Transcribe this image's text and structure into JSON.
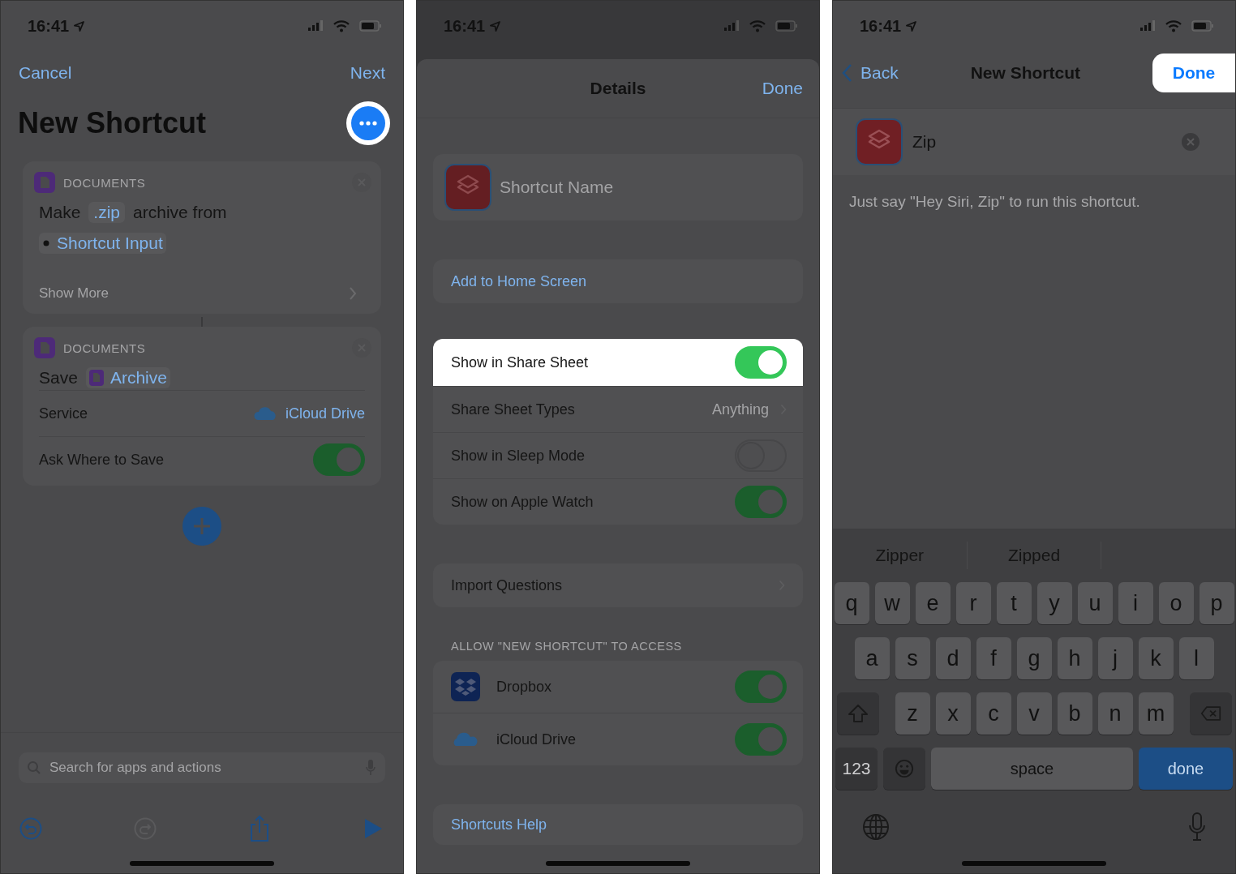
{
  "editor": {
    "status_time": "16:41",
    "cancel": "Cancel",
    "next": "Next",
    "title": "New Shortcut",
    "more_button": {
      "highlighted": true
    },
    "actions": [
      {
        "category": "DOCUMENTS",
        "lines": [
          [
            {
              "kind": "word",
              "text": "Make"
            },
            {
              "kind": "token",
              "text": ".zip"
            },
            {
              "kind": "word",
              "text": "archive from"
            }
          ],
          [
            {
              "kind": "variable",
              "text": "Shortcut Input"
            }
          ]
        ],
        "show_more": "Show More"
      },
      {
        "category": "DOCUMENTS",
        "lines": [
          [
            {
              "kind": "word",
              "text": "Save"
            },
            {
              "kind": "file",
              "text": "Archive"
            }
          ]
        ],
        "params": [
          {
            "kind": "value",
            "label": "Service",
            "value": "iCloud Drive"
          },
          {
            "kind": "toggle",
            "label": "Ask Where to Save",
            "on": true
          }
        ]
      }
    ],
    "search": {
      "placeholder": "Search for apps and actions"
    }
  },
  "details": {
    "status_time": "16:41",
    "title": "Details",
    "done": "Done",
    "name_placeholder": "Shortcut Name",
    "add_home": "Add to Home Screen",
    "settings": [
      {
        "kind": "toggle",
        "label": "Show in Share Sheet",
        "on": true,
        "highlighted": true
      },
      {
        "kind": "disclosure",
        "label": "Share Sheet Types",
        "value": "Anything"
      },
      {
        "kind": "toggle",
        "label": "Show in Sleep Mode",
        "on": false,
        "highlighted": false
      },
      {
        "kind": "toggle",
        "label": "Show on Apple Watch",
        "on": true,
        "highlighted": false
      }
    ],
    "import_questions": "Import Questions",
    "access_header": "ALLOW \"NEW SHORTCUT\" TO ACCESS",
    "access": [
      {
        "name": "Dropbox",
        "on": true
      },
      {
        "name": "iCloud Drive",
        "on": true
      }
    ],
    "help": "Shortcuts Help"
  },
  "naming": {
    "status_time": "16:41",
    "back": "Back",
    "title": "New Shortcut",
    "done": {
      "label": "Done",
      "highlighted": true
    },
    "name_value": "Zip",
    "hint": "Just say \"Hey Siri, Zip\" to run this shortcut.",
    "suggestions": [
      "Zipper",
      "Zipped"
    ],
    "key_rows": [
      [
        "q",
        "w",
        "e",
        "r",
        "t",
        "y",
        "u",
        "i",
        "o",
        "p"
      ],
      [
        "a",
        "s",
        "d",
        "f",
        "g",
        "h",
        "j",
        "k",
        "l"
      ],
      [
        "z",
        "x",
        "c",
        "v",
        "b",
        "n",
        "m"
      ]
    ],
    "numbers_key": "123",
    "space_key": "space",
    "return_key": "done"
  }
}
